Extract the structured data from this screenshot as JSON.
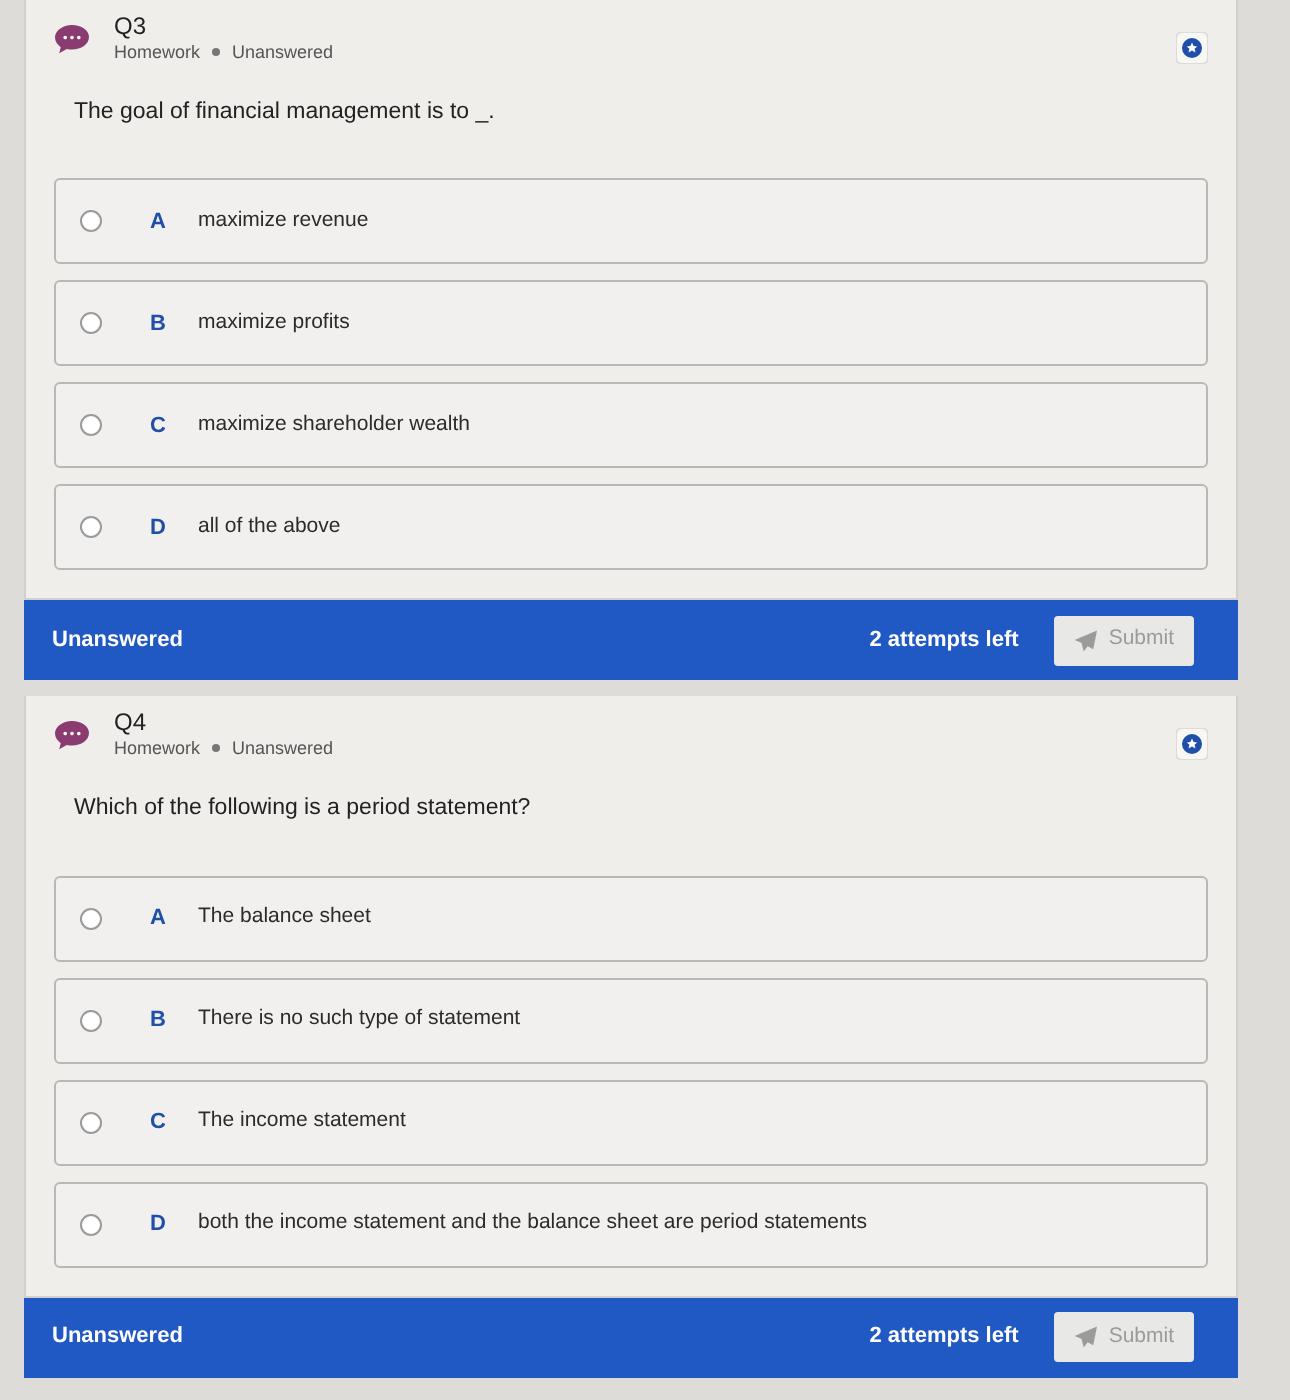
{
  "questions": [
    {
      "number": "Q3",
      "meta": [
        "Homework",
        "Unanswered"
      ],
      "prompt": "The goal of financial management is to _.",
      "options": [
        {
          "letter": "A",
          "text": "maximize revenue",
          "selected": false
        },
        {
          "letter": "B",
          "text": "maximize profits",
          "selected": false
        },
        {
          "letter": "C",
          "text": "maximize shareholder wealth",
          "selected": false
        },
        {
          "letter": "D",
          "text": "all of the above",
          "selected": false
        }
      ],
      "footer": {
        "status": "Unanswered",
        "attempts": "2 attempts left",
        "submit": "Submit",
        "submit_disabled": true
      }
    },
    {
      "number": "Q4",
      "meta": [
        "Homework",
        "Unanswered"
      ],
      "prompt": "Which of the following is a period statement?",
      "options": [
        {
          "letter": "A",
          "text": "The balance sheet",
          "selected": false
        },
        {
          "letter": "B",
          "text": "There is no such type of statement",
          "selected": false
        },
        {
          "letter": "C",
          "text": "The income statement",
          "selected": false
        },
        {
          "letter": "D",
          "text": "both the income statement and the balance sheet are period statements",
          "selected": false
        }
      ],
      "footer": {
        "status": "Unanswered",
        "attempts": "2 attempts left",
        "submit": "Submit",
        "submit_disabled": true
      }
    }
  ]
}
